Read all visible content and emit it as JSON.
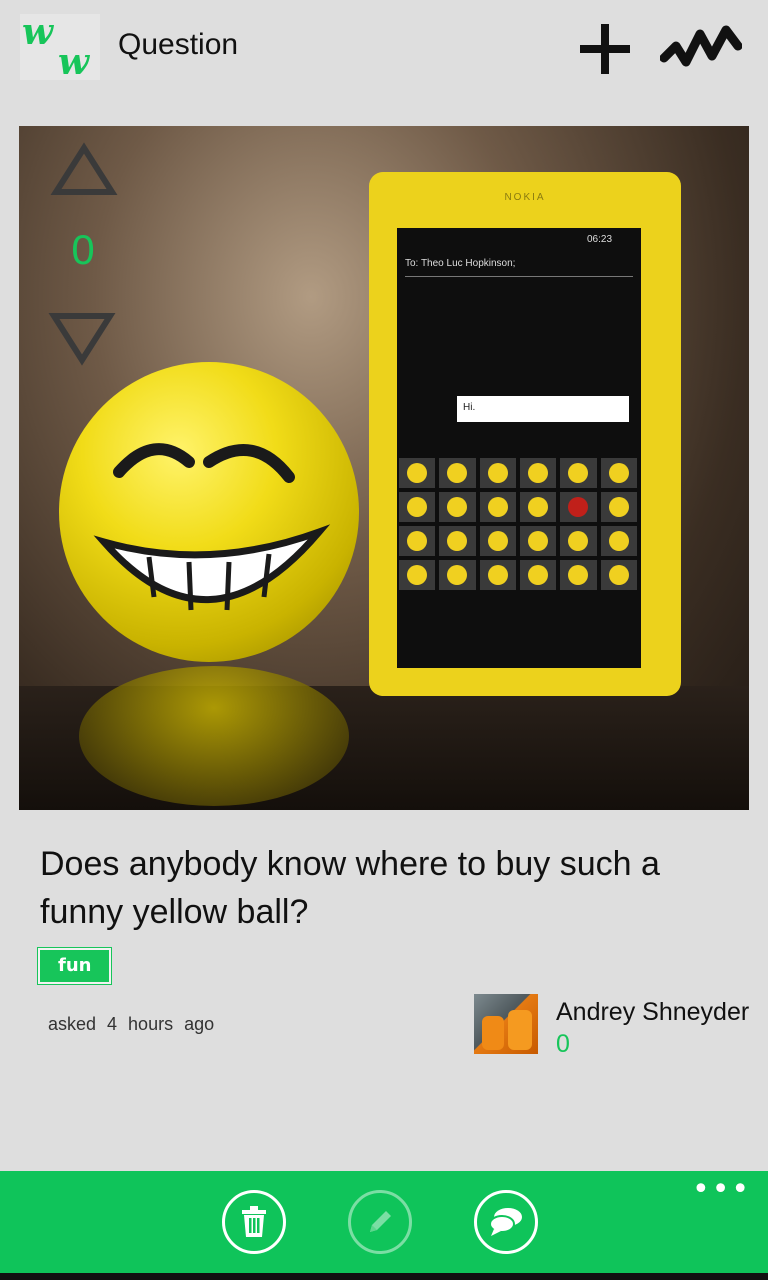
{
  "header": {
    "logo_letters": [
      "w",
      "w"
    ],
    "title": "Question",
    "add_icon": "plus-icon",
    "activity_icon": "pulse-wave-icon"
  },
  "post": {
    "votes": "0",
    "question": "Does anybody know where to buy such a funny yellow ball?",
    "tag": "fun",
    "asked_time": "asked  4 hours  ago",
    "author": {
      "name": "Andrey Shneyder",
      "score": "0"
    }
  },
  "photo_overlay": {
    "brand": "NOKIA",
    "time": "06:23",
    "to_line": "To: Theo Luc Hopkinson;",
    "message": "Hi."
  },
  "appbar": {
    "buttons": [
      {
        "icon": "trash-icon",
        "enabled": true
      },
      {
        "icon": "pencil-icon",
        "enabled": false
      },
      {
        "icon": "chat-bubbles-icon",
        "enabled": true
      }
    ],
    "more": "•••"
  },
  "colors": {
    "accent": "#17c55a",
    "appbar": "#0fc45a",
    "background": "#dedede"
  }
}
